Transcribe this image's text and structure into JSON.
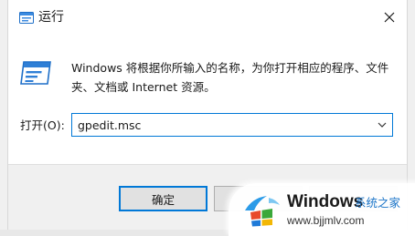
{
  "window": {
    "title": "运行",
    "close_label": "✕"
  },
  "dialog": {
    "description": "Windows 将根据你所输入的名称，为你打开相应的程序、文件夹、文档或 Internet 资源。",
    "open_label": "打开(O):",
    "input_value": "gpedit.msc"
  },
  "buttons": {
    "ok_label": "确定",
    "cancel_label": "",
    "browse_label": ""
  },
  "watermark": {
    "brand": "Windows",
    "sub": "系统之家",
    "url": "www.bjjmlv.com"
  },
  "icons": {
    "title": "run-icon",
    "close": "close-icon",
    "run": "run-icon",
    "dropdown": "chevron-down-icon",
    "watermark_logo": "windows-logo-icon"
  },
  "colors": {
    "accent": "#0078d7",
    "watermark_sub": "#1a74c8"
  }
}
